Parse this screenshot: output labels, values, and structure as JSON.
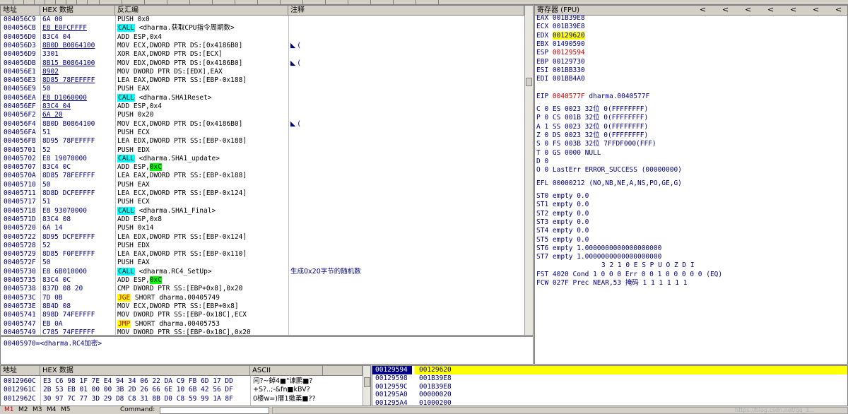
{
  "colors": {
    "call_bg": "#00ffff",
    "jmp_bg": "#ffff00",
    "imm_hl": "#00ff00",
    "addr": "#000080",
    "changed_reg": "#c00000",
    "stack_top": "#ffff00",
    "stack_sel": "#000080"
  },
  "disasm": {
    "headers": {
      "addr": "地址",
      "hex": "HEX 数据",
      "disasm": "反汇编",
      "comment": "注释"
    },
    "rows": [
      {
        "a": "004056C9",
        "h": "6A 00",
        "d": "PUSH 0x0",
        "c": ""
      },
      {
        "a": "004056CB",
        "h": "E8 E0FCFFFF",
        "u": true,
        "pre": "CALL",
        "d": " <dharma.获取CPU指令周期数>",
        "c": ""
      },
      {
        "a": "004056D0",
        "h": "83C4 04",
        "d": "ADD ESP,0x4",
        "c": ""
      },
      {
        "a": "004056D3",
        "h": "8B0D B0864100",
        "u": true,
        "d": "MOV ECX,DWORD PTR DS:[0x4186B0]",
        "c": "◣ ("
      },
      {
        "a": "004056D9",
        "h": "3301",
        "d": "XOR EAX,DWORD PTR DS:[ECX]",
        "c": ""
      },
      {
        "a": "004056DB",
        "h": "8B15 B0864100",
        "u": true,
        "d": "MOV EDX,DWORD PTR DS:[0x4186B0]",
        "c": "◣ ("
      },
      {
        "a": "004056E1",
        "h": "8902",
        "u": true,
        "d": "MOV DWORD PTR DS:[EDX],EAX",
        "c": ""
      },
      {
        "a": "004056E3",
        "h": "8D85 78FEFFFF",
        "u": true,
        "d": "LEA EAX,DWORD PTR SS:[EBP-0x188]",
        "c": ""
      },
      {
        "a": "004056E9",
        "h": "50",
        "d": "PUSH EAX",
        "c": ""
      },
      {
        "a": "004056EA",
        "h": "E8 D1060000",
        "u": true,
        "pre": "CALL",
        "d": " <dharma.SHA1Reset>",
        "c": ""
      },
      {
        "a": "004056EF",
        "h": "83C4 04",
        "u": true,
        "d": "ADD ESP,0x4",
        "c": ""
      },
      {
        "a": "004056F2",
        "h": "6A 20",
        "u": true,
        "d": "PUSH 0x20",
        "c": ""
      },
      {
        "a": "004056F4",
        "h": "8B0D B0864100",
        "d": "MOV ECX,DWORD PTR DS:[0x4186B0]",
        "c": "◣ ("
      },
      {
        "a": "004056FA",
        "h": "51",
        "d": "PUSH ECX",
        "c": ""
      },
      {
        "a": "004056FB",
        "h": "8D95 78FEFFFF",
        "d": "LEA EDX,DWORD PTR SS:[EBP-0x188]",
        "c": ""
      },
      {
        "a": "00405701",
        "h": "52",
        "d": "PUSH EDX",
        "c": ""
      },
      {
        "a": "00405702",
        "h": "E8 19070000",
        "pre": "CALL",
        "d": " <dharma.SHA1_update>",
        "c": ""
      },
      {
        "a": "00405707",
        "h": "83C4 0C",
        "d": "ADD ESP,",
        "hl": "0xC",
        "c": ""
      },
      {
        "a": "0040570A",
        "h": "8D85 78FEFFFF",
        "d": "LEA EAX,DWORD PTR SS:[EBP-0x188]",
        "c": ""
      },
      {
        "a": "00405710",
        "h": "50",
        "d": "PUSH EAX",
        "c": ""
      },
      {
        "a": "00405711",
        "h": "8D8D DCFEFFFF",
        "d": "LEA ECX,DWORD PTR SS:[EBP-0x124]",
        "c": ""
      },
      {
        "a": "00405717",
        "h": "51",
        "d": "PUSH ECX",
        "c": ""
      },
      {
        "a": "00405718",
        "h": "E8 93070000",
        "pre": "CALL",
        "d": " <dharma.SHA1_Final>",
        "c": ""
      },
      {
        "a": "0040571D",
        "h": "83C4 08",
        "d": "ADD ESP,0x8",
        "c": ""
      },
      {
        "a": "00405720",
        "h": "6A 14",
        "d": "PUSH 0x14",
        "c": ""
      },
      {
        "a": "00405722",
        "h": "8D95 DCFEFFFF",
        "d": "LEA EDX,DWORD PTR SS:[EBP-0x124]",
        "c": ""
      },
      {
        "a": "00405728",
        "h": "52",
        "d": "PUSH EDX",
        "c": ""
      },
      {
        "a": "00405729",
        "h": "8D85 F0FEFFFF",
        "d": "LEA EAX,DWORD PTR SS:[EBP-0x110]",
        "c": ""
      },
      {
        "a": "0040572F",
        "h": "50",
        "d": "PUSH EAX",
        "c": ""
      },
      {
        "a": "00405730",
        "h": "E8 6B010000",
        "pre": "CALL",
        "d": " <dharma.RC4_SetUp>",
        "c": "生成0x20字节的随机数"
      },
      {
        "a": "00405735",
        "h": "83C4 0C",
        "d": "ADD ESP,",
        "hl": "0xC",
        "c": ""
      },
      {
        "a": "00405738",
        "h": "837D 08 20",
        "d": "CMP DWORD PTR SS:[EBP+0x8],0x20",
        "c": ""
      },
      {
        "a": "0040573C",
        "h": "7D 0B",
        "pre": "JGE",
        "j": true,
        "d": " SHORT dharma.00405749",
        "c": ""
      },
      {
        "a": "0040573E",
        "h": "8B4D 08",
        "d": "MOV ECX,DWORD PTR SS:[EBP+0x8]",
        "c": ""
      },
      {
        "a": "00405741",
        "h": "898D 74FEFFFF",
        "d": "MOV DWORD PTR SS:[EBP-0x18C],ECX",
        "c": ""
      },
      {
        "a": "00405747",
        "h": "EB 0A",
        "pre": "JMP",
        "j": true,
        "d": " SHORT dharma.00405753",
        "c": ""
      },
      {
        "a": "00405749",
        "h": "C785 74FEFFFF",
        "d": "MOV DWORD PTR SS:[EBP-0x18C],0x20",
        "c": ""
      }
    ],
    "info_line": "00405970=<dharma.RC4加密>"
  },
  "registers": {
    "header": "寄存器 (FPU)",
    "arrows": [
      "<",
      "<",
      "<",
      "<",
      "<",
      "<",
      "<"
    ],
    "gp": [
      {
        "n": "EAX",
        "v": "001B39E8",
        "s": ""
      },
      {
        "n": "ECX",
        "v": "001B39E8",
        "s": ""
      },
      {
        "n": "EDX",
        "v": "00129620",
        "s": "y"
      },
      {
        "n": "EBX",
        "v": "01490590",
        "s": ""
      },
      {
        "n": "ESP",
        "v": "00129594",
        "s": "r"
      },
      {
        "n": "EBP",
        "v": "00129730",
        "s": ""
      },
      {
        "n": "ESI",
        "v": "001BB330",
        "s": ""
      },
      {
        "n": "EDI",
        "v": "001BB4A0",
        "s": ""
      }
    ],
    "eip": {
      "n": "EIP",
      "v": "0040577F",
      "t": "dharma.0040577F"
    },
    "segs": [
      "C 0  ES 0023 32位 0(FFFFFFFF)",
      "P 0  CS 001B 32位 0(FFFFFFFF)",
      "A 1  SS 0023 32位 0(FFFFFFFF)",
      "Z 0  DS 0023 32位 0(FFFFFFFF)",
      "S 0  FS 003B 32位 7FFDF000(FFF)",
      "T 0  GS 0000 NULL",
      "D 0",
      "O 0  LastErr ERROR_SUCCESS (00000000)"
    ],
    "efl": "EFL 00000212 (NO,NB,NE,A,NS,PO,GE,G)",
    "st": [
      "ST0 empty 0.0",
      "ST1 empty 0.0",
      "ST2 empty 0.0",
      "ST3 empty 0.0",
      "ST4 empty 0.0",
      "ST5 empty 0.0",
      "ST6 empty 1.0000000000000000000",
      "ST7 empty 1.0000000000000000000"
    ],
    "fpu_hdr": "3 2 1 0      E S P U O Z D I",
    "fst": "FST 4020  Cond 1 0 0 0  Err 0 0 1 0 0 0 0 0  (EQ)",
    "fcw": "FCW 027F  Prec NEAR,53  掩码    1 1 1 1 1 1"
  },
  "dump": {
    "headers": {
      "addr": "地址",
      "hex": "HEX 数据",
      "ascii": "ASCII"
    },
    "rows": [
      {
        "a": "0012960C",
        "h": "E3 C6 98 1F 7E E4 94 34 06 22 DA C9 FB 6D 17 DD",
        "s": "闫?~鋽4■\"谏鹏■?"
      },
      {
        "a": "0012961C",
        "h": "2B 53 EB 01 00 00 3B 2D 26 66 6E 10 6B 42 56 DF",
        "s": "+S?..;-&fn■kBV?"
      },
      {
        "a": "0012962C",
        "h": "30 97 7C 77 3D 29 D8 C8 31 8B D0 C8 59 99 1A 8F",
        "s": "0楼w=)厝1嬓葇■??"
      }
    ]
  },
  "stack": {
    "rows": [
      {
        "a": "00129594",
        "v": "00129620"
      },
      {
        "a": "00129598",
        "v": "001B39E8"
      },
      {
        "a": "0012959C",
        "v": "001B39E8"
      },
      {
        "a": "001295A0",
        "v": "00000020"
      },
      {
        "a": "001295A4",
        "v": "01000200"
      }
    ]
  },
  "bottom": {
    "tabs": [
      "M1",
      "M2",
      "M3",
      "M4",
      "M5"
    ],
    "command_label": "Command:",
    "watermark": "https://blog.csdn.net/qq_3..."
  }
}
